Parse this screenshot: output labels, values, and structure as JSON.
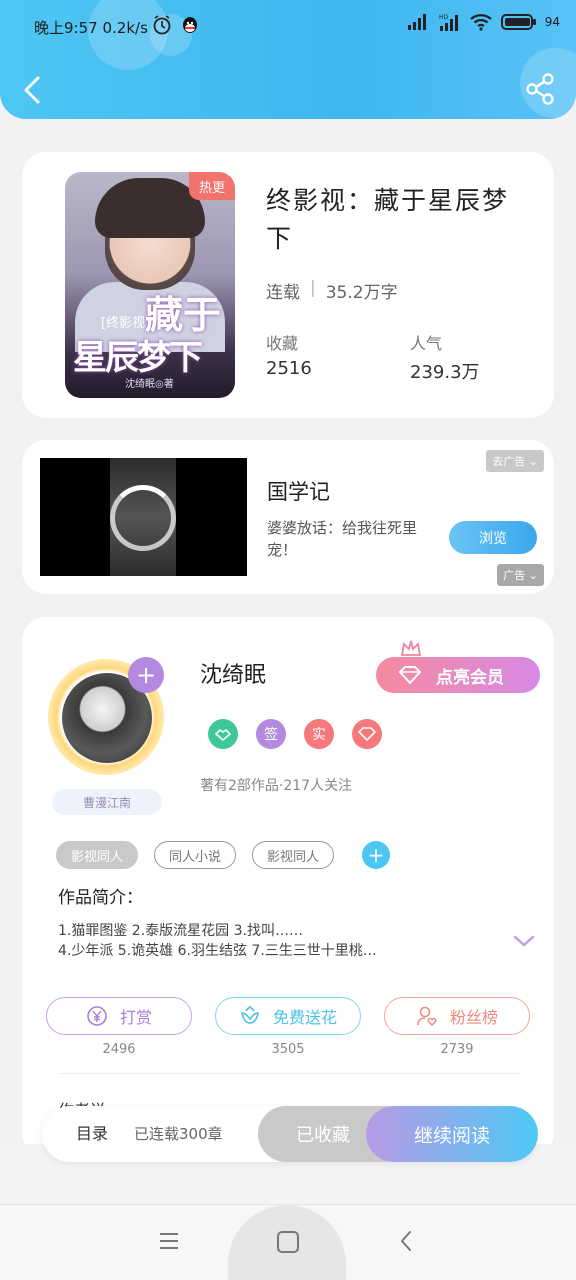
{
  "status_bar": {
    "time": "晚上9:57",
    "speed": "0.2k/s",
    "battery": "94",
    "icons": [
      "alarm-icon",
      "qq-icon",
      "signal-icon",
      "hd-signal-icon",
      "wifi-icon",
      "battery-icon"
    ]
  },
  "header": {
    "back_icon": "chevron-left-icon",
    "share_icon": "share-icon"
  },
  "book": {
    "title": "终影视：藏于星辰梦下",
    "status": "连载",
    "word_count": "35.2万字",
    "favorites_label": "收藏",
    "favorites_value": "2516",
    "popularity_label": "人气",
    "popularity_value": "239.3万",
    "cover": {
      "hot_badge": "热更",
      "small_title": "[终影视]",
      "title_line1": "藏于",
      "title_line2": "星辰梦下",
      "author_line": "沈绮眠◎著"
    }
  },
  "ad": {
    "title": "国学记",
    "description": "婆婆放话：给我往死里宠！",
    "button_label": "浏览",
    "tag_top": "去广告",
    "tag_bottom": "广告"
  },
  "author": {
    "name": "沈绮眠",
    "vip_label": "点亮会员",
    "fan_badge": "曹漫江南",
    "badges": [
      {
        "icon": "handshake-icon",
        "color": "#3ec89a"
      },
      {
        "label": "签",
        "color": "#b48ae0"
      },
      {
        "label": "实",
        "color": "#f5797a"
      },
      {
        "icon": "diamond-icon",
        "color": "#f5797a"
      }
    ],
    "info": "著有2部作品·217人关注",
    "tags": [
      "影视同人",
      "同人小说",
      "影视同人"
    ],
    "intro_label": "作品简介：",
    "intro_line1": "1.猫罪图鉴 2.泰版流星花园 3.找叫……",
    "intro_line2": "4.少年派 5.诡英雄 6.羽生结弦 7.三生三世十里桃…",
    "actions": [
      {
        "label": "打赏",
        "count": "2496",
        "color": "#c9a0e8",
        "text_color": "#a97fd7",
        "icon": "yen-coin-icon"
      },
      {
        "label": "免费送花",
        "count": "3505",
        "color": "#7fd5ee",
        "text_color": "#4cc1e8",
        "icon": "flower-icon"
      },
      {
        "label": "粉丝榜",
        "count": "2739",
        "color": "#f2a69c",
        "text_color": "#ee8a80",
        "icon": "user-heart-icon"
      }
    ],
    "section_peek": "作者说"
  },
  "read_bar": {
    "toc": "目录",
    "serial": "已连载300章",
    "collected": "已收藏",
    "continue": "继续阅读"
  },
  "navbar": {
    "icons": [
      "menu-icon",
      "home-square-icon",
      "back-triangle-icon"
    ]
  }
}
